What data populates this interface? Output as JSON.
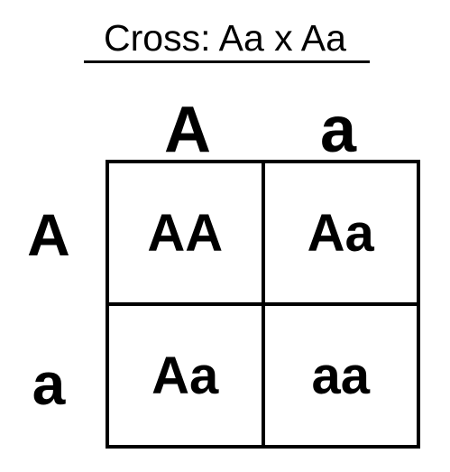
{
  "title": "Cross: Aa x Aa",
  "columns": [
    "A",
    "a"
  ],
  "rows": [
    "A",
    "a"
  ],
  "cells": [
    "AA",
    "Aa",
    "Aa",
    "aa"
  ]
}
